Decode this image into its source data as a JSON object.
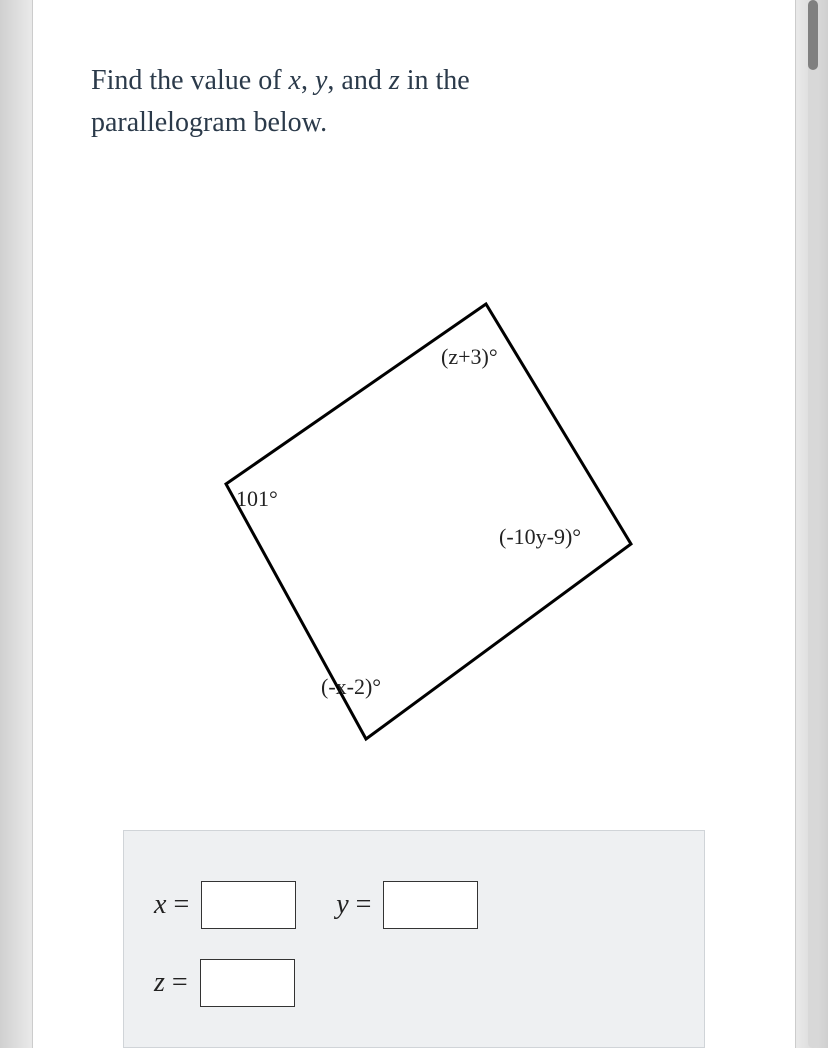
{
  "question": {
    "line1_pre": "Find the value of ",
    "var_x": "x",
    "sep1": ", ",
    "var_y": "y",
    "sep2": ", and ",
    "var_z": "z",
    "line1_post": " in the",
    "line2": "parallelogram below."
  },
  "diagram": {
    "angle_top": "(z+3)°",
    "angle_left": "101°",
    "angle_right": "(-10y-9)°",
    "angle_bottom": "(-x-2)°"
  },
  "answers": {
    "x_label": "x",
    "y_label": "y",
    "z_label": "z",
    "eq": "=",
    "x_value": "",
    "y_value": "",
    "z_value": ""
  }
}
